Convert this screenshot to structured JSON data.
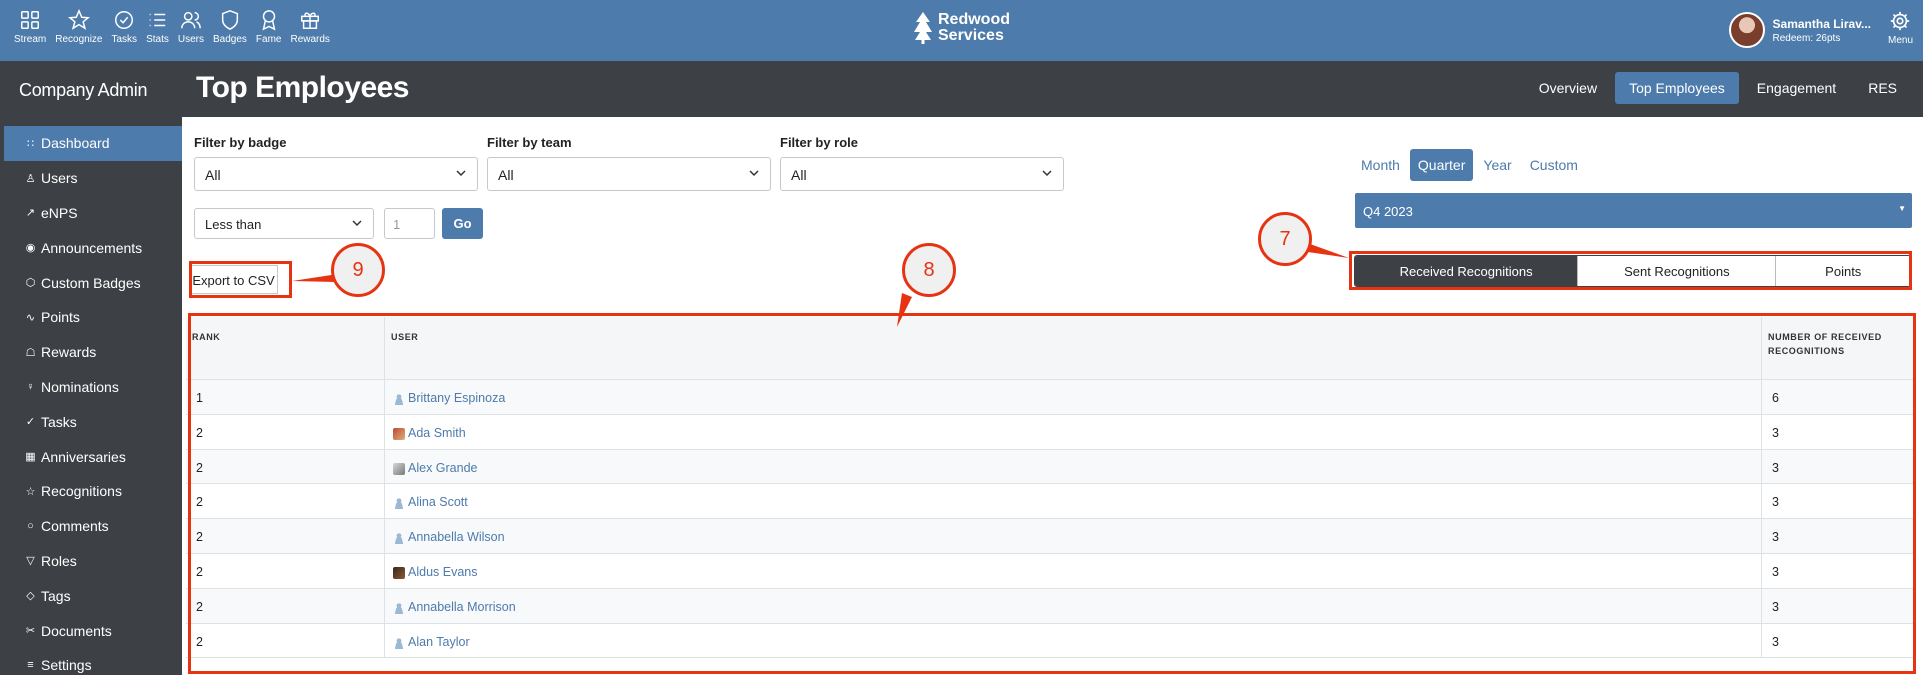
{
  "topnav": {
    "items": [
      {
        "label": "Stream",
        "icon": "grid-icon"
      },
      {
        "label": "Recognize",
        "icon": "star-icon"
      },
      {
        "label": "Tasks",
        "icon": "check-circle-icon"
      },
      {
        "label": "Stats",
        "icon": "list-icon"
      },
      {
        "label": "Users",
        "icon": "users-icon"
      },
      {
        "label": "Badges",
        "icon": "shield-icon"
      },
      {
        "label": "Fame",
        "icon": "award-icon"
      },
      {
        "label": "Rewards",
        "icon": "gift-icon"
      }
    ],
    "brand_line1": "Redwood",
    "brand_line2": "Services",
    "user_name": "Samantha Lirav...",
    "user_redeem": "Redeem: 26pts",
    "menu_label": "Menu"
  },
  "sidebar": {
    "title": "Company Admin",
    "items": [
      {
        "label": "Dashboard",
        "icon": "bar-chart-icon",
        "glyph": "∷",
        "active": true
      },
      {
        "label": "Users",
        "icon": "user-icon",
        "glyph": "♙"
      },
      {
        "label": "eNPS",
        "icon": "trend-icon",
        "glyph": "↗"
      },
      {
        "label": "Announcements",
        "icon": "broadcast-icon",
        "glyph": "◉"
      },
      {
        "label": "Custom Badges",
        "icon": "shield-icon",
        "glyph": "⬡"
      },
      {
        "label": "Points",
        "icon": "activity-icon",
        "glyph": "∿"
      },
      {
        "label": "Rewards",
        "icon": "gift-icon",
        "glyph": "☖"
      },
      {
        "label": "Nominations",
        "icon": "award-icon",
        "glyph": "♀"
      },
      {
        "label": "Tasks",
        "icon": "check-circle-icon",
        "glyph": "✓"
      },
      {
        "label": "Anniversaries",
        "icon": "calendar-icon",
        "glyph": "▦"
      },
      {
        "label": "Recognitions",
        "icon": "star-icon",
        "glyph": "☆"
      },
      {
        "label": "Comments",
        "icon": "comment-icon",
        "glyph": "○"
      },
      {
        "label": "Roles",
        "icon": "filter-icon",
        "glyph": "▽"
      },
      {
        "label": "Tags",
        "icon": "tag-icon",
        "glyph": "◇"
      },
      {
        "label": "Documents",
        "icon": "paperclip-icon",
        "glyph": "✂"
      },
      {
        "label": "Settings",
        "icon": "sliders-icon",
        "glyph": "≡"
      }
    ]
  },
  "header": {
    "title": "Top Employees",
    "tabs": [
      {
        "label": "Overview",
        "active": false
      },
      {
        "label": "Top Employees",
        "active": true
      },
      {
        "label": "Engagement",
        "active": false
      },
      {
        "label": "RES",
        "active": false
      }
    ]
  },
  "filters": {
    "badge_label": "Filter by badge",
    "badge_value": "All",
    "team_label": "Filter by team",
    "team_value": "All",
    "role_label": "Filter by role",
    "role_value": "All",
    "compare_value": "Less than",
    "number_placeholder": "1",
    "go_label": "Go"
  },
  "period": {
    "options": [
      {
        "label": "Month",
        "active": false
      },
      {
        "label": "Quarter",
        "active": true
      },
      {
        "label": "Year",
        "active": false
      },
      {
        "label": "Custom",
        "active": false
      }
    ],
    "selected": "Q4 2023"
  },
  "export_label": "Export to CSV",
  "segments": [
    {
      "label": "Received Recognitions",
      "active": true
    },
    {
      "label": "Sent Recognitions",
      "active": false
    },
    {
      "label": "Points",
      "active": false
    }
  ],
  "table": {
    "headers": {
      "rank": "RANK",
      "user": "USER",
      "count_line1": "NUMBER OF RECEIVED",
      "count_line2": "RECOGNITIONS"
    },
    "rows": [
      {
        "rank": "1",
        "user": "Brittany Espinoza",
        "avatar": "default",
        "count": "6"
      },
      {
        "rank": "2",
        "user": "Ada Smith",
        "avatar": "photo1",
        "count": "3"
      },
      {
        "rank": "2",
        "user": "Alex Grande",
        "avatar": "photo2",
        "count": "3"
      },
      {
        "rank": "2",
        "user": "Alina Scott",
        "avatar": "default",
        "count": "3"
      },
      {
        "rank": "2",
        "user": "Annabella Wilson",
        "avatar": "default",
        "count": "3"
      },
      {
        "rank": "2",
        "user": "Aldus Evans",
        "avatar": "photo3",
        "count": "3"
      },
      {
        "rank": "2",
        "user": "Annabella Morrison",
        "avatar": "default",
        "count": "3"
      },
      {
        "rank": "2",
        "user": "Alan Taylor",
        "avatar": "default",
        "count": "3"
      }
    ]
  },
  "annotations": {
    "callout_7": "7",
    "callout_8": "8",
    "callout_9": "9",
    "color": "#e63312"
  }
}
